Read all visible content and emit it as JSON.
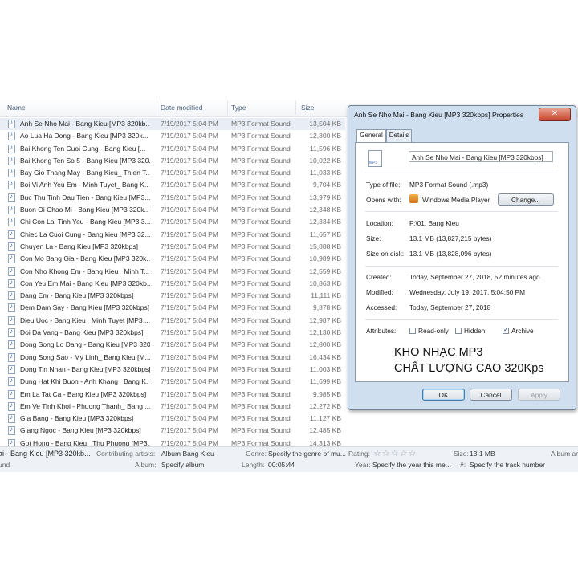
{
  "columns": {
    "name": "Name",
    "date": "Date modified",
    "type": "Type",
    "size": "Size"
  },
  "files": [
    {
      "name": "Anh Se Nho Mai - Bang Kieu [MP3 320kb...",
      "date": "7/19/2017 5:04 PM",
      "type": "MP3 Format Sound",
      "size": "13,504 KB",
      "selected": true
    },
    {
      "name": "Ao Lua Ha Dong - Bang Kieu [MP3 320k...",
      "date": "7/19/2017 5:04 PM",
      "type": "MP3 Format Sound",
      "size": "12,800 KB"
    },
    {
      "name": "Bai Khong Ten Cuoi Cung - Bang Kieu [...",
      "date": "7/19/2017 5:04 PM",
      "type": "MP3 Format Sound",
      "size": "11,596 KB"
    },
    {
      "name": "Bai Khong Ten So 5 - Bang Kieu [MP3 320...",
      "date": "7/19/2017 5:04 PM",
      "type": "MP3 Format Sound",
      "size": "10,022 KB"
    },
    {
      "name": "Bay Gio Thang May - Bang Kieu_ Thien T...",
      "date": "7/19/2017 5:04 PM",
      "type": "MP3 Format Sound",
      "size": "11,033 KB"
    },
    {
      "name": "Boi Vi Anh Yeu Em - Minh Tuyet_ Bang K...",
      "date": "7/19/2017 5:04 PM",
      "type": "MP3 Format Sound",
      "size": "9,704 KB"
    },
    {
      "name": "Buc Thu Tinh Dau Tien - Bang Kieu [MP3...",
      "date": "7/19/2017 5:04 PM",
      "type": "MP3 Format Sound",
      "size": "13,979 KB"
    },
    {
      "name": "Buon Oi Chao Mi - Bang Kieu [MP3 320k...",
      "date": "7/19/2017 5:04 PM",
      "type": "MP3 Format Sound",
      "size": "12,348 KB"
    },
    {
      "name": "Chi Con Lai Tinh Yeu - Bang Kieu [MP3 3...",
      "date": "7/19/2017 5:04 PM",
      "type": "MP3 Format Sound",
      "size": "12,334 KB"
    },
    {
      "name": "Chiec La Cuoi Cung - Bang kieu [MP3 32...",
      "date": "7/19/2017 5:04 PM",
      "type": "MP3 Format Sound",
      "size": "11,657 KB"
    },
    {
      "name": "Chuyen La - Bang Kieu [MP3 320kbps]",
      "date": "7/19/2017 5:04 PM",
      "type": "MP3 Format Sound",
      "size": "15,888 KB"
    },
    {
      "name": "Con Mo Bang Gia - Bang Kieu [MP3 320k...",
      "date": "7/19/2017 5:04 PM",
      "type": "MP3 Format Sound",
      "size": "10,989 KB"
    },
    {
      "name": "Con Nho Khong Em - Bang Kieu_ Minh T...",
      "date": "7/19/2017 5:04 PM",
      "type": "MP3 Format Sound",
      "size": "12,559 KB"
    },
    {
      "name": "Con Yeu Em Mai - Bang Kieu [MP3 320kb...",
      "date": "7/19/2017 5:04 PM",
      "type": "MP3 Format Sound",
      "size": "10,863 KB"
    },
    {
      "name": "Dang Em - Bang Kieu [MP3 320kbps]",
      "date": "7/19/2017 5:04 PM",
      "type": "MP3 Format Sound",
      "size": "11,111 KB"
    },
    {
      "name": "Dem Dam Say - Bang Kieu [MP3 320kbps]",
      "date": "7/19/2017 5:04 PM",
      "type": "MP3 Format Sound",
      "size": "9,878 KB"
    },
    {
      "name": "Dieu Uoc - Bang Kieu_ Minh Tuyet [MP3 ...",
      "date": "7/19/2017 5:04 PM",
      "type": "MP3 Format Sound",
      "size": "12,987 KB"
    },
    {
      "name": "Doi Da Vang - Bang Kieu [MP3 320kbps]",
      "date": "7/19/2017 5:04 PM",
      "type": "MP3 Format Sound",
      "size": "12,130 KB"
    },
    {
      "name": "Dong Song Lo Dang - Bang Kieu [MP3 320...",
      "date": "7/19/2017 5:04 PM",
      "type": "MP3 Format Sound",
      "size": "12,800 KB"
    },
    {
      "name": "Dong Song Sao - My Linh_ Bang Kieu [M...",
      "date": "7/19/2017 5:04 PM",
      "type": "MP3 Format Sound",
      "size": "16,434 KB"
    },
    {
      "name": "Dong Tin Nhan - Bang Kieu [MP3 320kbps]",
      "date": "7/19/2017 5:04 PM",
      "type": "MP3 Format Sound",
      "size": "11,003 KB"
    },
    {
      "name": "Dung Hat Khi Buon - Anh Khang_ Bang K...",
      "date": "7/19/2017 5:04 PM",
      "type": "MP3 Format Sound",
      "size": "11,699 KB"
    },
    {
      "name": "Em La Tat Ca - Bang Kieu [MP3 320kbps]",
      "date": "7/19/2017 5:04 PM",
      "type": "MP3 Format Sound",
      "size": "9,985 KB"
    },
    {
      "name": "Em Ve Tinh Khoi - Phuong Thanh_ Bang ...",
      "date": "7/19/2017 5:04 PM",
      "type": "MP3 Format Sound",
      "size": "12,272 KB"
    },
    {
      "name": "Gia Bang - Bang Kieu [MP3 320kbps]",
      "date": "7/19/2017 5:04 PM",
      "type": "MP3 Format Sound",
      "size": "11,127 KB"
    },
    {
      "name": "Giang Ngoc - Bang Kieu [MP3 320kbps]",
      "date": "7/19/2017 5:04 PM",
      "type": "MP3 Format Sound",
      "size": "12,485 KB"
    },
    {
      "name": "Got Hong - Bang Kieu_ Thu Phuong [MP3...",
      "date": "7/19/2017 5:04 PM",
      "type": "MP3 Format Sound",
      "size": "14,313 KB"
    }
  ],
  "details": {
    "title_partial": "ai - Bang Kieu [MP3 320kb...",
    "contributing_artists_label": "Contributing artists:",
    "contributing_artists_value": "Album Bang Kieu",
    "album_label": "Album:",
    "album_value": "Specify album",
    "genre_label": "Genre:",
    "genre_value": "Specify the genre of mu...",
    "length_label": "Length:",
    "length_value": "00:05:44",
    "rating_label": "Rating:",
    "rating_stars": "☆☆☆☆☆",
    "year_label": "Year:",
    "year_value": "Specify the year this me...",
    "size_label": "Size:",
    "size_value": "13.1 MB",
    "track_label": "#:",
    "track_value": "Specify the track number",
    "album_artist_partial": "Album ar",
    "left_partial": "und"
  },
  "dialog": {
    "title": "Anh Se Nho Mai - Bang Kieu [MP3 320kbps] Properties",
    "close": "✕",
    "tabs": [
      "General",
      "Details"
    ],
    "filename": "Anh Se Nho Mai - Bang Kieu [MP3 320kbps]",
    "type_label": "Type of file:",
    "type_value": "MP3 Format Sound (.mp3)",
    "opens_label": "Opens with:",
    "opens_value": "Windows Media Player",
    "change_button": "Change...",
    "location_label": "Location:",
    "location_value": "F:\\01. Bang Kieu",
    "size_label": "Size:",
    "size_value": "13.1 MB (13,827,215 bytes)",
    "disk_label": "Size on disk:",
    "disk_value": "13.1 MB (13,828,096 bytes)",
    "created_label": "Created:",
    "created_value": "Today, September 27, 2018, 52 minutes ago",
    "modified_label": "Modified:",
    "modified_value": "Wednesday, July 19, 2017, 5:04:50 PM",
    "accessed_label": "Accessed:",
    "accessed_value": "Today, September 27, 2018",
    "attributes_label": "Attributes:",
    "readonly_label": "Read-only",
    "hidden_label": "Hidden",
    "archive_label": "Archive",
    "archive_checked": true,
    "ok_button": "OK",
    "cancel_button": "Cancel",
    "apply_button": "Apply"
  },
  "promo": {
    "line1": "KHO NHẠC MP3",
    "line2": "CHẤT LƯỢNG CAO 320Kps"
  }
}
